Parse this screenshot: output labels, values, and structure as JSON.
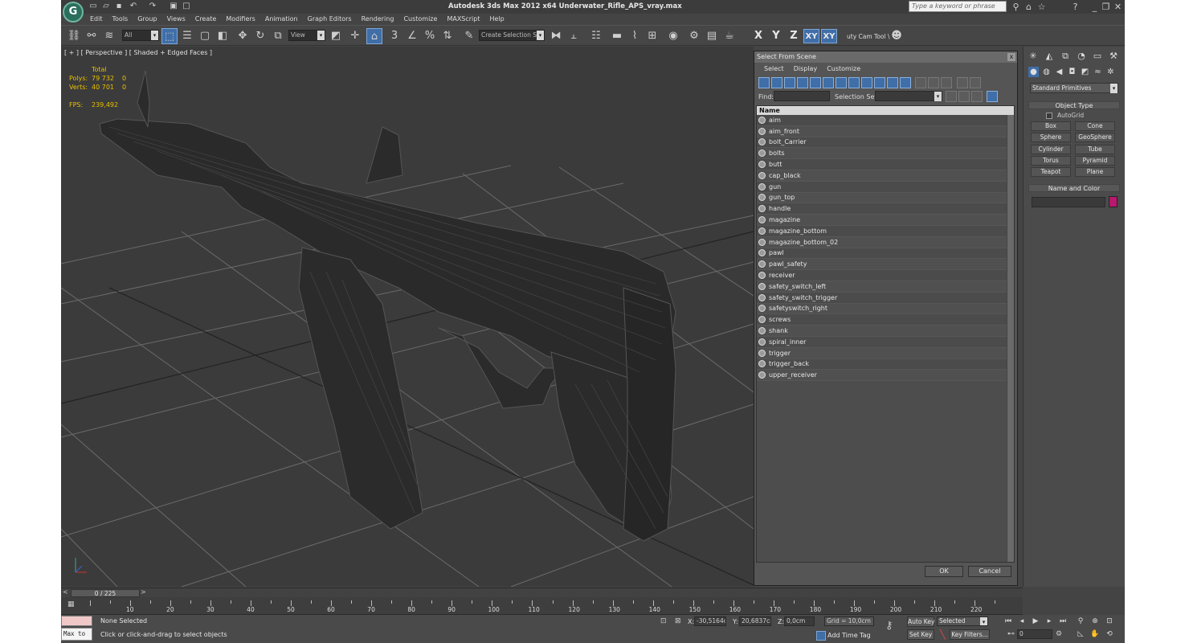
{
  "app": {
    "title": "Autodesk 3ds Max  2012 x64      Underwater_Rifle_APS_vray.max",
    "logo_glyph": "G",
    "search_placeholder": "Type a keyword or phrase"
  },
  "menu": [
    "Edit",
    "Tools",
    "Group",
    "Views",
    "Create",
    "Modifiers",
    "Animation",
    "Graph Editors",
    "Rendering",
    "Customize",
    "MAXScript",
    "Help"
  ],
  "toolbar": {
    "filter_value": "All",
    "refcoord_value": "View",
    "selection_set_value": "Create Selection Se",
    "axis_x": "X",
    "axis_y": "Y",
    "axis_z": "Z",
    "axis_xy": "XY",
    "axis_xy2": "XY",
    "snap_3": "3",
    "angle_snap": "∠",
    "percent_snap": "%",
    "utility_label": "uty Cam Tool \\"
  },
  "viewport": {
    "label": "[ + ] [ Perspective ] [ Shaded + Edged Faces ]",
    "stats_header": "Total",
    "polys_label": "Polys:",
    "polys_total": "79 732",
    "polys_sel": "0",
    "verts_label": "Verts:",
    "verts_total": "40 701",
    "verts_sel": "0",
    "fps_label": "FPS:",
    "fps_value": "239,492"
  },
  "dialog": {
    "title": "Select From Scene",
    "close": "x",
    "menu": [
      "Select",
      "Display",
      "Customize"
    ],
    "find_label": "Find:",
    "selection_set_label": "Selection Set:",
    "column_name": "Name",
    "ok": "OK",
    "cancel": "Cancel",
    "objects": [
      "aim",
      "aim_front",
      "bolt_Carrier",
      "bolts",
      "butt",
      "cap_black",
      "gun",
      "gun_top",
      "handle",
      "magazine",
      "magazine_bottom",
      "magazine_bottom_02",
      "pawl",
      "pawl_safety",
      "receiver",
      "safety_switch_left",
      "safety_switch_trigger",
      "safetyswitch_right",
      "screws",
      "shank",
      "spiral_inner",
      "trigger",
      "trigger_back",
      "upper_receiver"
    ]
  },
  "command_panel": {
    "category": "Standard Primitives",
    "object_type_title": "Object Type",
    "autogrid": "AutoGrid",
    "primitives": [
      "Box",
      "Cone",
      "Sphere",
      "GeoSphere",
      "Cylinder",
      "Tube",
      "Torus",
      "Pyramid",
      "Teapot",
      "Plane"
    ],
    "name_color_title": "Name and Color",
    "swatch_color": "#b8186d"
  },
  "timeline": {
    "slider_text": "0 / 225",
    "ticks": [
      "10",
      "20",
      "30",
      "40",
      "50",
      "60",
      "70",
      "80",
      "90",
      "100",
      "110",
      "120",
      "130",
      "140",
      "150",
      "160",
      "170",
      "180",
      "190",
      "200",
      "210",
      "220"
    ]
  },
  "status": {
    "maxscript": "Max to",
    "selection": "None Selected",
    "prompt": "Click or click-and-drag to select objects",
    "x_label": "X:",
    "x_value": "-30,5164cr",
    "y_label": "Y:",
    "y_value": "20,6837cm",
    "z_label": "Z:",
    "z_value": "0,0cm",
    "grid": "Grid = 10,0cm",
    "auto_key": "Auto Key",
    "set_key": "Set Key",
    "key_mode": "Selected",
    "key_filters": "Key Filters...",
    "add_time_tag": "Add Time Tag",
    "frame": "0"
  }
}
